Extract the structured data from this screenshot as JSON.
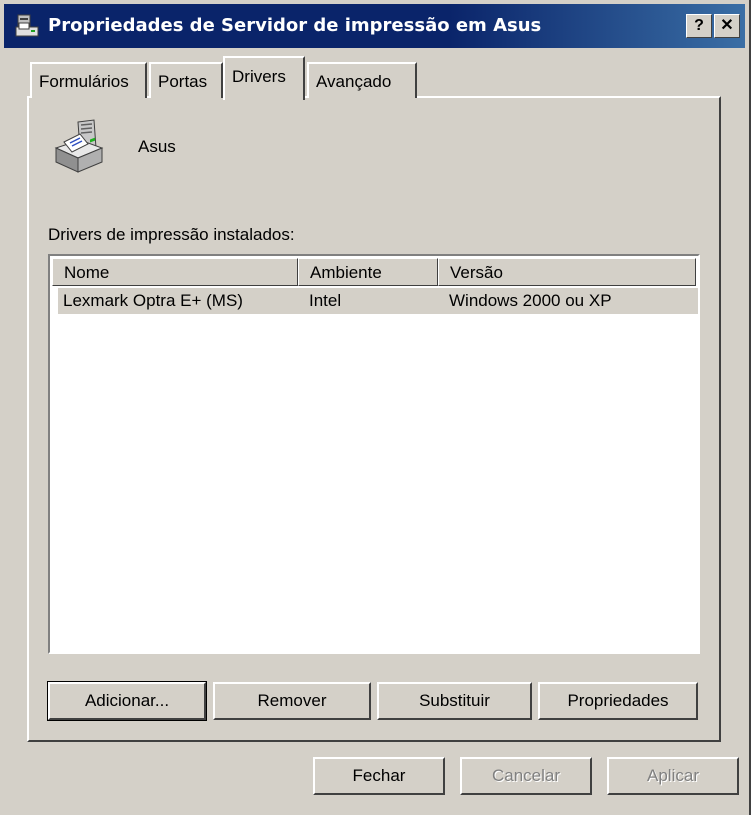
{
  "window": {
    "title": "Propriedades de Servidor de impressão em Asus",
    "help_label": "?",
    "close_label": "✕"
  },
  "tabs": [
    {
      "label": "Formulários"
    },
    {
      "label": "Portas"
    },
    {
      "label": "Drivers"
    },
    {
      "label": "Avançado"
    }
  ],
  "server": {
    "name": "Asus",
    "icon": "printer-icon"
  },
  "drivers": {
    "label": "Drivers de impressão instalados:",
    "columns": [
      "Nome",
      "Ambiente",
      "Versão"
    ],
    "rows": [
      {
        "name": "Lexmark Optra E+ (MS)",
        "environment": "Intel",
        "version": "Windows 2000 ou XP"
      }
    ]
  },
  "actions": {
    "add": "Adicionar...",
    "remove": "Remover",
    "replace": "Substituir",
    "properties": "Propriedades"
  },
  "footer": {
    "close": "Fechar",
    "cancel": "Cancelar",
    "apply": "Aplicar"
  },
  "colors": {
    "titlebar": "#0a246a",
    "face": "#d4d0c8"
  }
}
